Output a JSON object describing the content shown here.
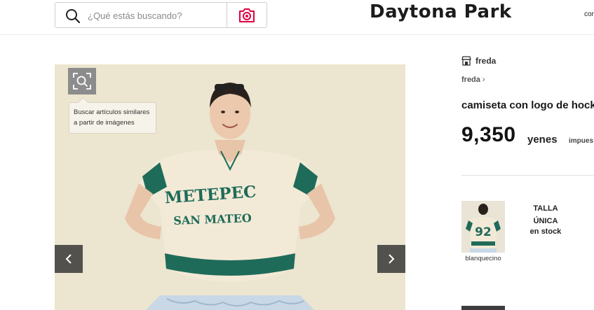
{
  "header": {
    "search_placeholder": "¿Qué estás buscando?",
    "logo": "Daytona Park",
    "cut_text": "cor"
  },
  "product_image": {
    "shirt_text_line1": "METEPEC",
    "shirt_text_line2": "SAN MATEO",
    "visual_search_tooltip_line1": "Buscar artículos similares",
    "visual_search_tooltip_line2": "a partir de imágenes"
  },
  "product": {
    "brand": "freda",
    "brand_link": "freda",
    "title": "camiseta con logo de hocke",
    "price": "9,350",
    "currency": "yenes",
    "tax": "impues"
  },
  "variant": {
    "thumb_number": "92",
    "color": "blanquecino",
    "size_line1": "TALLA",
    "size_line2": "ÚNICA",
    "stock": "en stock"
  },
  "colors": {
    "accent": "#e0003c",
    "shirt_green": "#1f6b59",
    "shirt_cream": "#f2ead7",
    "background": "#ece5cf"
  }
}
